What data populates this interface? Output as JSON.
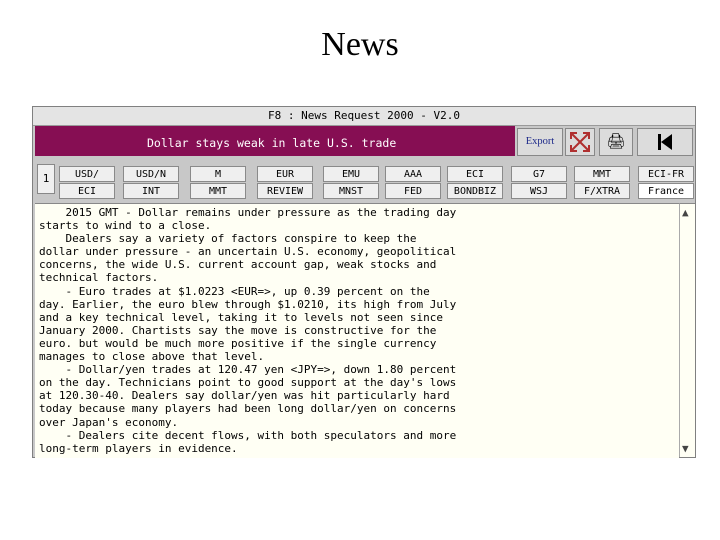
{
  "slide": {
    "title": "News"
  },
  "window": {
    "title": "F8 : News Request 2000 - V2.0",
    "headline": "Dollar stays weak in late U.S. trade",
    "export_label": "Export",
    "left_tab_label": "1"
  },
  "buttons_top": [
    "USD/",
    "USD/N",
    "M",
    "EUR",
    "EMU",
    "AAA",
    "ECI",
    "G7",
    "MMT",
    "ECI-FR"
  ],
  "buttons_bottom": [
    "ECI",
    "INT",
    "MMT",
    "REVIEW",
    "MNST",
    "FED",
    "BONDBIZ",
    "WSJ",
    "F/XTRA",
    "France"
  ],
  "story_lines": [
    "    2015 GMT - Dollar remains under pressure as the trading day",
    "starts to wind to a close.",
    "    Dealers say a variety of factors conspire to keep the",
    "dollar under pressure - an uncertain U.S. economy, geopolitical",
    "concerns, the wide U.S. current account gap, weak stocks and",
    "technical factors.",
    "    - Euro trades at $1.0223 <EUR=>, up 0.39 percent on the",
    "day. Earlier, the euro blew through $1.0210, its high from July",
    "and a key technical level, taking it to levels not seen since",
    "January 2000. Chartists say the move is constructive for the",
    "euro. but would be much more positive if the single currency",
    "manages to close above that level.",
    "    - Dollar/yen trades at 120.47 yen <JPY=>, down 1.80 percent",
    "on the day. Technicians point to good support at the day's lows",
    "at 120.30-40. Dealers say dollar/yen was hit particularly hard",
    "today because many players had been long dollar/yen on concerns",
    "over Japan's economy.",
    "    - Dealers cite decent flows, with both speculators and more",
    "long-term players in evidence."
  ]
}
